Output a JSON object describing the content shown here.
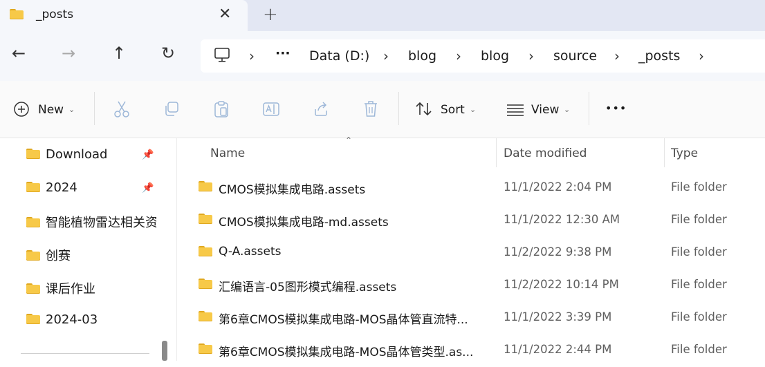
{
  "tab": {
    "title": "_posts",
    "close": "✕",
    "new_tab": "+"
  },
  "nav": {
    "back": "←",
    "forward": "→",
    "up": "↑",
    "refresh": "↻",
    "overflow": "···",
    "breadcrumbs": [
      "Data (D:)",
      "blog",
      "blog",
      "source",
      "_posts"
    ],
    "separator": "›"
  },
  "toolbar": {
    "new_label": "New",
    "sort_label": "Sort",
    "view_label": "View",
    "more": "•••"
  },
  "sidebar": {
    "items": [
      {
        "label": "Download",
        "pinned": true
      },
      {
        "label": "2024",
        "pinned": true
      },
      {
        "label": "智能植物雷达相关资料",
        "pinned": false
      },
      {
        "label": "创赛",
        "pinned": false
      },
      {
        "label": "课后作业",
        "pinned": false
      },
      {
        "label": "2024-03",
        "pinned": false
      }
    ]
  },
  "list": {
    "columns": {
      "name": "Name",
      "date": "Date modified",
      "type": "Type"
    },
    "rows": [
      {
        "name": "CMOS模拟集成电路.assets",
        "date": "11/1/2022 2:04 PM",
        "type": "File folder"
      },
      {
        "name": "CMOS模拟集成电路-md.assets",
        "date": "11/1/2022 12:30 AM",
        "type": "File folder"
      },
      {
        "name": "Q-A.assets",
        "date": "11/2/2022 9:38 PM",
        "type": "File folder"
      },
      {
        "name": "汇编语言-05图形模式编程.assets",
        "date": "11/2/2022 10:14 PM",
        "type": "File folder"
      },
      {
        "name": "第6章CMOS模拟集成电路-MOS晶体管直流特...",
        "date": "11/1/2022 3:39 PM",
        "type": "File folder"
      },
      {
        "name": "第6章CMOS模拟集成电路-MOS晶体管类型.as...",
        "date": "11/1/2022 2:44 PM",
        "type": "File folder"
      }
    ]
  }
}
